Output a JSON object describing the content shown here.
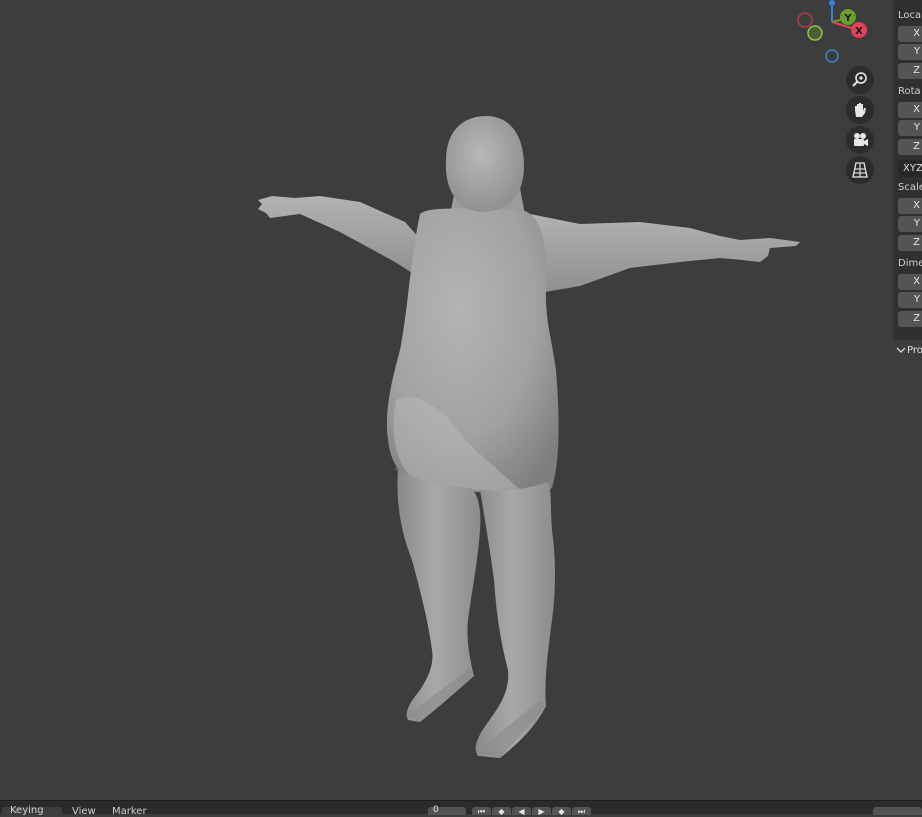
{
  "viewport": {
    "gizmo": {
      "x_label": "X",
      "y_label": "Y",
      "color_x": "#e2415a",
      "color_y": "#6b9e2a",
      "color_z": "#3b7fd6"
    },
    "nav_buttons": [
      "zoom-icon",
      "hand-pan-icon",
      "camera-icon",
      "grid-perspective-icon"
    ]
  },
  "npanel": {
    "location_label": "Loca",
    "rotation_label": "Rota",
    "scale_label": "Scale",
    "dimensions_label": "Dime",
    "axis_x": "X",
    "axis_y": "Y",
    "axis_z": "Z",
    "rotation_mode": "XYZ",
    "properties_header": "Pro"
  },
  "timeline": {
    "keying_label": "Keying",
    "view_label": "View",
    "marker_label": "Marker",
    "current_frame": "0"
  }
}
